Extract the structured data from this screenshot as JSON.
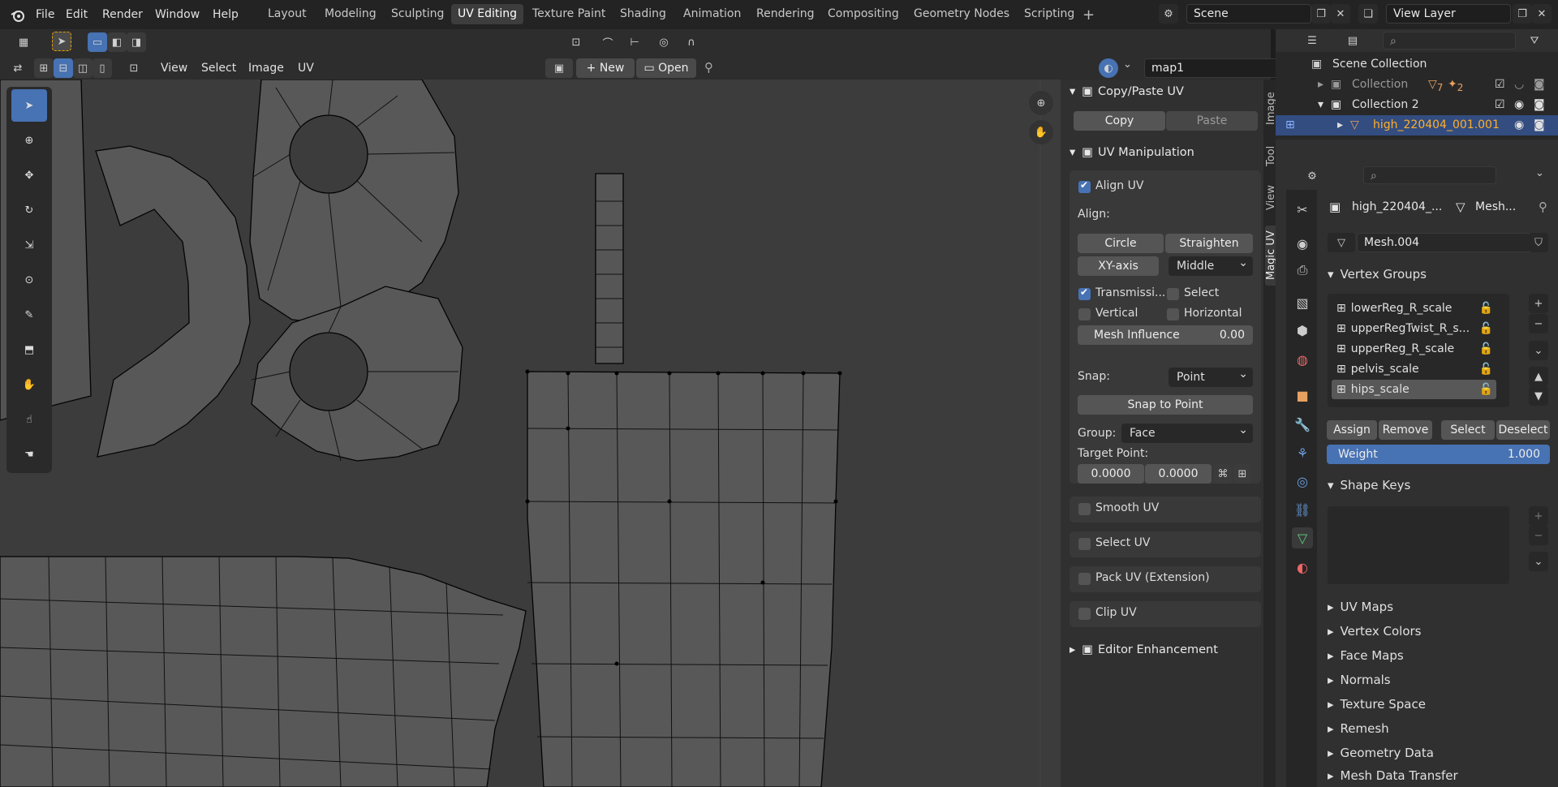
{
  "menus": [
    "File",
    "Edit",
    "Render",
    "Window",
    "Help"
  ],
  "workspaces": [
    "Layout",
    "Modeling",
    "Sculpting",
    "UV Editing",
    "Texture Paint",
    "Shading",
    "Animation",
    "Rendering",
    "Compositing",
    "Geometry Nodes",
    "Scripting"
  ],
  "active_workspace": "UV Editing",
  "scene": "Scene",
  "view_layer": "View Layer",
  "uv_header": {
    "view": "View",
    "select": "Select",
    "image": "Image",
    "uv": "UV",
    "new": "New",
    "open": "Open",
    "uvmap": "map1"
  },
  "copy_paste": {
    "title": "Copy/Paste UV",
    "copy": "Copy",
    "paste": "Paste"
  },
  "uv_manip": {
    "title": "UV Manipulation",
    "align_uv": "Align UV",
    "align_label": "Align:",
    "circle": "Circle",
    "straighten": "Straighten",
    "xy_axis": "XY-axis",
    "middle": "Middle",
    "transmission": "Transmissi...",
    "select": "Select",
    "vertical": "Vertical",
    "horizontal": "Horizontal",
    "mesh_influence": "Mesh Influence",
    "mesh_influence_val": "0.00",
    "snap": "Snap:",
    "snap_val": "Point",
    "snap_to_point": "Snap to Point",
    "group": "Group:",
    "group_val": "Face",
    "target_point": "Target Point:",
    "tp_x": "0.0000",
    "tp_y": "0.0000",
    "smooth_uv": "Smooth UV",
    "select_uv": "Select UV",
    "pack_uv": "Pack UV (Extension)",
    "clip_uv": "Clip UV"
  },
  "editor_enh": "Editor Enhancement",
  "vtabs": [
    "Image",
    "Tool",
    "View",
    "Magic UV"
  ],
  "outliner": {
    "scene_collection": "Scene Collection",
    "collection": "Collection",
    "collection2": "Collection 2",
    "object": "high_220404_001.001",
    "badge1": "7",
    "badge2": "2"
  },
  "props": {
    "object_name": "high_220404_...",
    "mesh_short": "Mesh...",
    "mesh_data": "Mesh.004",
    "vertex_groups": "Vertex Groups",
    "vg_items": [
      "lowerReg_R_scale",
      "upperRegTwist_R_s...",
      "upperReg_R_scale",
      "pelvis_scale",
      "hips_scale"
    ],
    "assign": "Assign",
    "remove": "Remove",
    "select": "Select",
    "deselect": "Deselect",
    "weight": "Weight",
    "weight_val": "1.000",
    "shape_keys": "Shape Keys",
    "sections": [
      "UV Maps",
      "Vertex Colors",
      "Face Maps",
      "Normals",
      "Texture Space",
      "Remesh",
      "Geometry Data",
      "Mesh Data Transfer"
    ]
  },
  "colors": {
    "accent": "#4772b3",
    "highlight_text": "#ffaf29"
  }
}
